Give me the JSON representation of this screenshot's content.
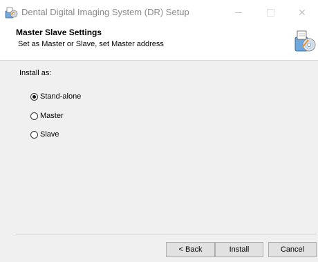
{
  "window": {
    "title": "Dental Digital Imaging System (DR) Setup",
    "app_icon": "setup-icon",
    "controls": {
      "minimize_icon": "minimize-icon",
      "maximize_icon": "maximize-icon",
      "close_icon": "close-icon",
      "close_glyph": "✕"
    }
  },
  "header": {
    "title": "Master Slave Settings",
    "subtitle": "Set as Master or Slave, set Master address",
    "icon": "setup-icon"
  },
  "content": {
    "install_as_label": "Install as:",
    "options": [
      {
        "label": "Stand-alone",
        "selected": true
      },
      {
        "label": "Master",
        "selected": false
      },
      {
        "label": "Slave",
        "selected": false
      }
    ]
  },
  "buttons": {
    "back": "< Back",
    "install": "Install",
    "cancel": "Cancel"
  },
  "colors": {
    "body_bg": "#f0f0f0",
    "header_bg": "#ffffff",
    "title_text": "#888888",
    "button_bg": "#e1e1e1"
  }
}
